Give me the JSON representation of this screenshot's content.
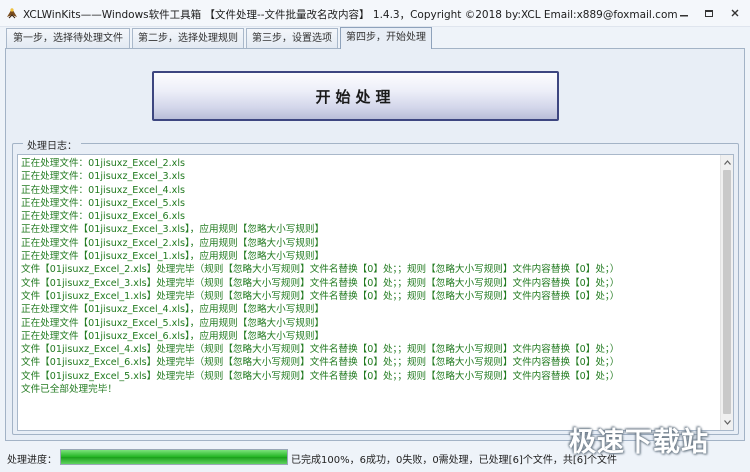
{
  "window": {
    "title": "XCLWinKits——Windows软件工具箱 【文件处理--文件批量改名改内容】 1.4.3，Copyright ©2018 by:XCL Email:x889@foxmail.com"
  },
  "tabs": [
    {
      "label": "第一步，选择待处理文件"
    },
    {
      "label": "第二步，选择处理规则"
    },
    {
      "label": "第三步，设置选项"
    },
    {
      "label": "第四步，开始处理"
    }
  ],
  "start_button": {
    "label": "开始处理"
  },
  "log": {
    "legend": "处理日志：",
    "lines": [
      "正在处理文件：01jisuxz_Excel_2.xls",
      "正在处理文件：01jisuxz_Excel_3.xls",
      "正在处理文件：01jisuxz_Excel_4.xls",
      "正在处理文件：01jisuxz_Excel_5.xls",
      "正在处理文件：01jisuxz_Excel_6.xls",
      "正在处理文件【01jisuxz_Excel_3.xls】，应用规则【忽略大小写规则】",
      "正在处理文件【01jisuxz_Excel_2.xls】，应用规则【忽略大小写规则】",
      "正在处理文件【01jisuxz_Excel_1.xls】，应用规则【忽略大小写规则】",
      "文件【01jisuxz_Excel_2.xls】处理完毕（规则【忽略大小写规则】文件名替换【0】处；；规则【忽略大小写规则】文件内容替换【0】处；）",
      "文件【01jisuxz_Excel_3.xls】处理完毕（规则【忽略大小写规则】文件名替换【0】处；；规则【忽略大小写规则】文件内容替换【0】处；）",
      "文件【01jisuxz_Excel_1.xls】处理完毕（规则【忽略大小写规则】文件名替换【0】处；；规则【忽略大小写规则】文件内容替换【0】处；）",
      "正在处理文件【01jisuxz_Excel_4.xls】，应用规则【忽略大小写规则】",
      "正在处理文件【01jisuxz_Excel_5.xls】，应用规则【忽略大小写规则】",
      "正在处理文件【01jisuxz_Excel_6.xls】，应用规则【忽略大小写规则】",
      "文件【01jisuxz_Excel_4.xls】处理完毕（规则【忽略大小写规则】文件名替换【0】处；；规则【忽略大小写规则】文件内容替换【0】处；）",
      "文件【01jisuxz_Excel_6.xls】处理完毕（规则【忽略大小写规则】文件名替换【0】处；；规则【忽略大小写规则】文件内容替换【0】处；）",
      "文件【01jisuxz_Excel_5.xls】处理完毕（规则【忽略大小写规则】文件名替换【0】处；；规则【忽略大小写规则】文件内容替换【0】处；）",
      "文件已全部处理完毕！"
    ],
    "text_color": "#217a1f"
  },
  "status": {
    "label": "处理进度：",
    "progress_percent": 100,
    "text": "已完成100%，6成功，0失败，0需处理，已处理[6]个文件，共[6]个文件"
  },
  "watermark": "极速下载站",
  "icons": {
    "app": "eagle-icon",
    "minimize": "minimize-icon",
    "restore": "restore-icon",
    "close": "close-icon"
  }
}
